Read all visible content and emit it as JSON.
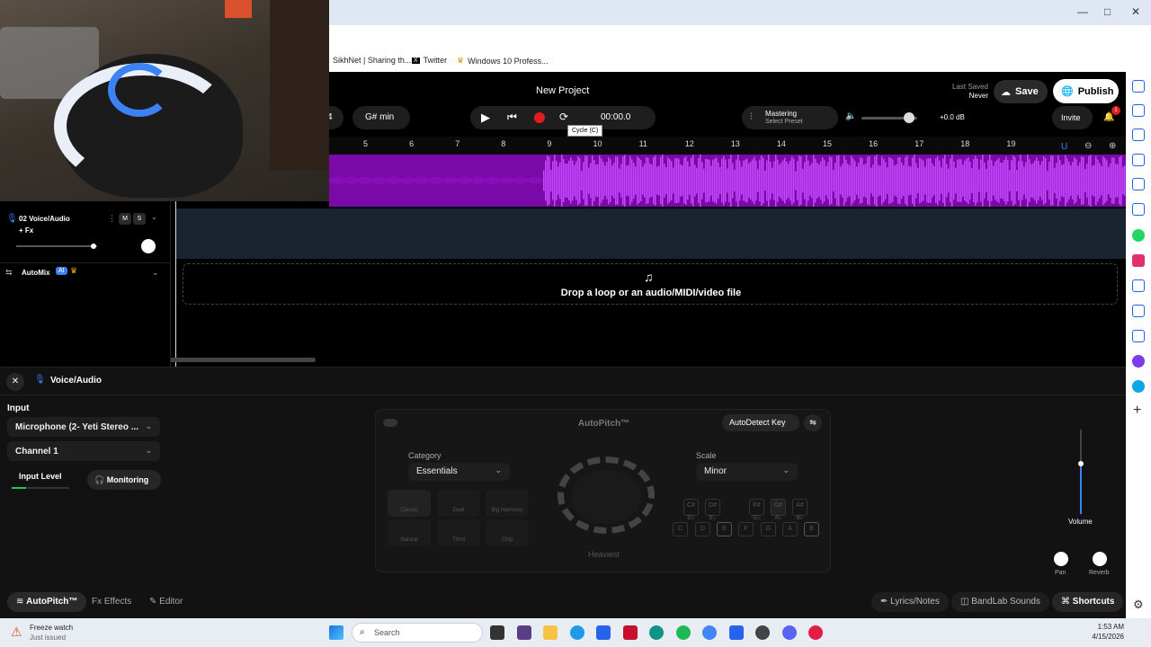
{
  "browser": {
    "bookmarks": [
      "SikhNet | Sharing th...",
      "Twitter",
      "Windows 10 Profess..."
    ],
    "window_controls": [
      "—",
      "□",
      "✕"
    ]
  },
  "header": {
    "project_title": "New Project",
    "last_saved_label": "Last Saved",
    "last_saved_value": "Never",
    "save_label": "Save",
    "publish_label": "Publish",
    "invite_label": "Invite",
    "notification_count": "1"
  },
  "transport": {
    "bar_value": "4",
    "key": "G# min",
    "time": "00:00.0",
    "tooltip": "Cycle (C)"
  },
  "mastering": {
    "title": "Mastering",
    "subtitle": "Select Preset",
    "gain": "+0.0 dB",
    "volume": 0.85
  },
  "ruler_ticks": [
    "5",
    "6",
    "7",
    "8",
    "9",
    "10",
    "11",
    "12",
    "13",
    "14",
    "15",
    "16",
    "17",
    "18",
    "19"
  ],
  "tracks": [
    {
      "name": "02  Voice/Audio",
      "fx": "+ Fx",
      "mute": "M",
      "solo": "S",
      "volume": 0.95
    },
    {
      "name": "AutoMix",
      "badge": "AI"
    }
  ],
  "drop_zone": "Drop a loop or an audio/MIDI/video file",
  "editor": {
    "title": "Voice/Audio",
    "input_label": "Input",
    "input_device": "Microphone (2- Yeti Stereo ...",
    "channel": "Channel 1",
    "input_level_label": "Input Level",
    "monitoring_label": "Monitoring",
    "input_level": 0.25
  },
  "autopitch": {
    "title": "AutoPitch™",
    "autodetect_label": "AutoDetect Key",
    "category_label": "Category",
    "category_value": "Essentials",
    "scale_label": "Scale",
    "scale_value": "Minor",
    "presets": [
      "Classic",
      "Duet",
      "Big Harmony",
      "Natural",
      "Third",
      "Chip"
    ],
    "knob_label": "Heaviest",
    "sharp_keys": [
      "C#\nD♭",
      "D#\nE♭",
      "F#\nG♭",
      "G#\nA♭",
      "A#\nB♭"
    ],
    "keys": [
      "C",
      "D",
      "E",
      "F",
      "G",
      "A",
      "B"
    ]
  },
  "mixer": {
    "volume_label": "Volume",
    "pan_label": "Pan",
    "reverb_label": "Reverb",
    "volume": 0.6
  },
  "bottom_tabs": {
    "autopitch": "AutoPitch™",
    "effects": "Effects",
    "editor": "Editor",
    "lyrics": "Lyrics/Notes",
    "sounds": "BandLab Sounds",
    "shortcuts": "Shortcuts"
  },
  "taskbar": {
    "notification_title": "Freeze watch",
    "notification_sub": "Just issued",
    "search_placeholder": "Search",
    "time": "1:53 AM",
    "date": "4/15/2026"
  },
  "colors": {
    "waveform": "#8b10c4",
    "record": "#e11d1d",
    "accent_blue": "#3b82f6"
  }
}
